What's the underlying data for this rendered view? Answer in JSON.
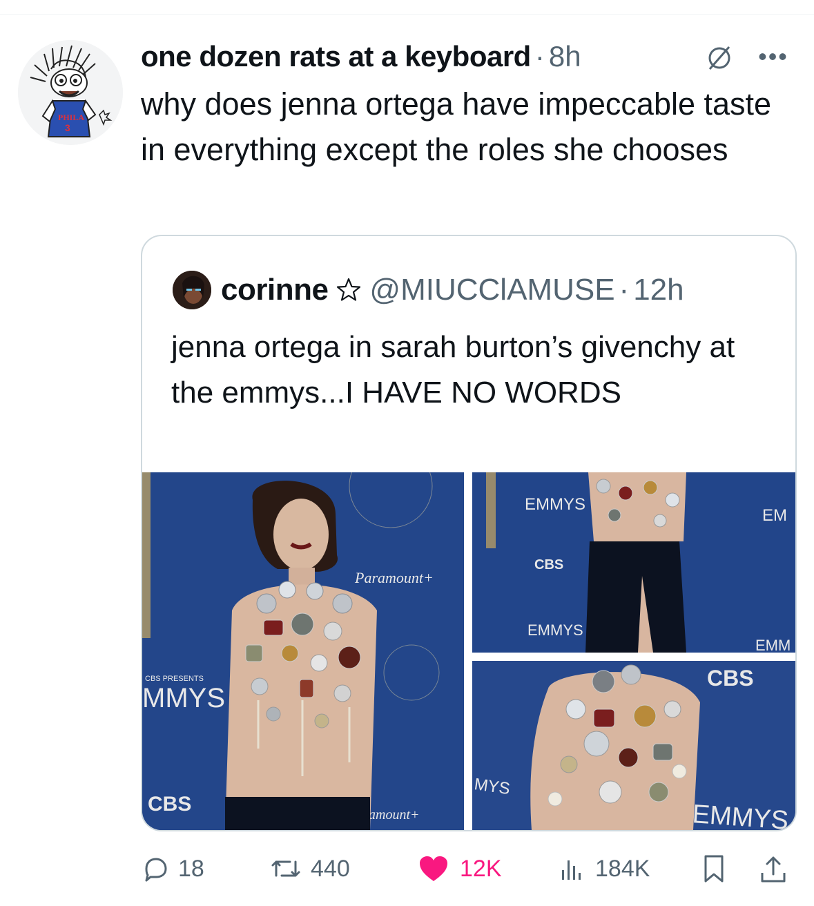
{
  "tweet": {
    "author_name": "one dozen rats at a keyboard",
    "separator": "·",
    "time": "8h",
    "text": "why does jenna ortega have impeccable taste in everything except the roles she chooses",
    "avatar_jersey_text": "PHILA",
    "avatar_jersey_number": "3"
  },
  "quoted_tweet": {
    "author_name": "corinne",
    "handle": "@MIUCClAMUSE",
    "separator": "·",
    "time": "12h",
    "text": "jenna ortega in sarah burton’s givenchy at the emmys...I HAVE NO WORDS",
    "photos": [
      {
        "signs": [
          "Paramount+",
          "CBS PRESENTS",
          "MMYS",
          "CBS",
          "amount+"
        ]
      },
      {
        "signs": [
          "EMMYS",
          "CBS",
          "EMMYS",
          "EM",
          "EMM"
        ]
      },
      {
        "signs": [
          "MYS",
          "CBS",
          "EMMYS"
        ]
      }
    ]
  },
  "actions": {
    "replies": "18",
    "reposts": "440",
    "likes": "12K",
    "views": "184K"
  },
  "colors": {
    "text": "#0f1419",
    "secondary": "#536471",
    "like": "#f91880",
    "border": "#cfd9de",
    "backdrop": "#1f3f7a"
  },
  "icons": [
    "mute-icon",
    "more-icon",
    "star-icon",
    "reply-icon",
    "repost-icon",
    "heart-icon",
    "views-icon",
    "bookmark-icon",
    "share-icon"
  ]
}
